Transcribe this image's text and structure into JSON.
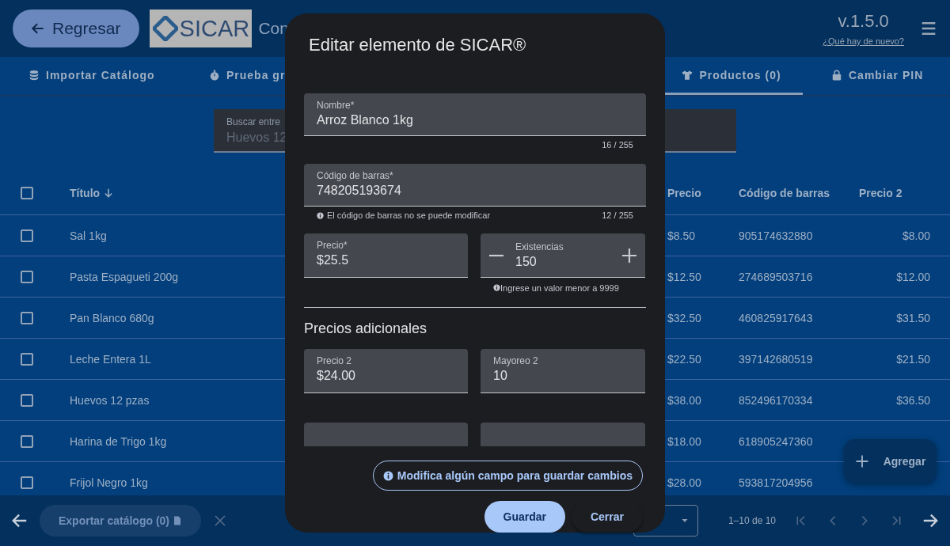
{
  "header": {
    "back_button": "Regresar",
    "logo_text": "SICAR",
    "title": "Con",
    "version": "v.1.5.0",
    "whats_new_link": "¿Qué hay de nuevo?"
  },
  "tabs": [
    {
      "label": "Importar Catálogo",
      "selected": false
    },
    {
      "label": "Prueba gr",
      "selected": false
    },
    {
      "label": "Productos (0)",
      "selected": true
    },
    {
      "label": "Cambiar PIN",
      "selected": false
    }
  ],
  "search": {
    "label": "Buscar entre",
    "placeholder": "Huevos 12"
  },
  "table": {
    "select_all_checked": false,
    "columns": [
      {
        "label": "Título",
        "sorted": true
      },
      {
        "label": "Precio",
        "sorted": false
      },
      {
        "label": "Código de barras",
        "sorted": false
      },
      {
        "label": "Precio 2",
        "sorted": false
      }
    ],
    "rows": [
      {
        "checked": false,
        "cells": [
          "Sal 1kg",
          "$8.50",
          "905174632880",
          "$8.00"
        ]
      },
      {
        "checked": false,
        "cells": [
          "Pasta Espagueti 200g",
          "$12.50",
          "274689503716",
          "$12.00"
        ]
      },
      {
        "checked": false,
        "cells": [
          "Pan Blanco 680g",
          "$32.50",
          "460825917643",
          "$31.50"
        ]
      },
      {
        "checked": false,
        "cells": [
          "Leche Entera 1L",
          "$22.50",
          "397142680519",
          "$21.50"
        ]
      },
      {
        "checked": false,
        "cells": [
          "Huevos 12 pzas",
          "$38.00",
          "852496170334",
          "$36.50"
        ]
      },
      {
        "checked": false,
        "cells": [
          "Harina de Trigo 1kg",
          "$18.00",
          "618905247360"
        ]
      },
      {
        "checked": false,
        "cells": [
          "Frijol Negro 1kg",
          "$28.00",
          "593817204956"
        ]
      }
    ]
  },
  "fab": {
    "label": "Agregar"
  },
  "footer": {
    "export_button": {
      "label": "Exportar catálogo (0)",
      "disabled": true
    },
    "range": "1–10 de 10"
  },
  "dialog": {
    "title": "Editar elemento de SICAR®",
    "nombre": {
      "label": "Nombre*",
      "value": "Arroz Blanco 1kg",
      "counter": "16 / 255"
    },
    "codigo": {
      "label": "Código de barras*",
      "value": "748205193674",
      "hint": "El código de barras no se puede modificar",
      "counter": "12 / 255"
    },
    "precio": {
      "label": "Precio*",
      "value": "$25.5"
    },
    "existencias": {
      "label": "Existencias",
      "value": "150",
      "hint": "Ingrese un valor menor a 9999"
    },
    "section_heading": "Precios adicionales",
    "extra_prices": [
      {
        "label": "Precio 2",
        "value": "$24.00"
      },
      {
        "label": "Mayoreo 2",
        "value": "10"
      }
    ],
    "notice": "Modifica algún campo para guardar cambios",
    "buttons": [
      {
        "label": "Guardar",
        "kind": "filled"
      },
      {
        "label": "Cerrar",
        "kind": "text"
      }
    ]
  }
}
